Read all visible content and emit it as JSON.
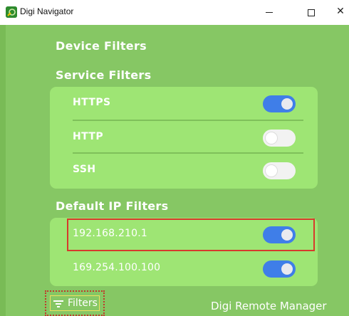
{
  "window": {
    "title": "Digi Navigator",
    "minimize_glyph": "—",
    "close_glyph": "✕"
  },
  "sections": {
    "device_filters": "Device Filters",
    "service_filters": "Service Filters",
    "default_ip_filters": "Default IP Filters"
  },
  "service_filters": [
    {
      "label": "HTTPS",
      "enabled": true
    },
    {
      "label": "HTTP",
      "enabled": false
    },
    {
      "label": "SSH",
      "enabled": false
    }
  ],
  "ip_filters": [
    {
      "label": "192.168.210.1",
      "enabled": true
    },
    {
      "label": "169.254.100.100",
      "enabled": true
    }
  ],
  "footer": {
    "filters_label": "Filters",
    "remote_manager_label": "Digi Remote Manager"
  },
  "colors": {
    "background": "#86c764",
    "card": "#9ee574",
    "toggle_on": "#3f7ee8",
    "highlight": "#d63a2c"
  },
  "icons": {
    "app": "digi-logo-icon",
    "filters": "filter-lines-icon"
  }
}
